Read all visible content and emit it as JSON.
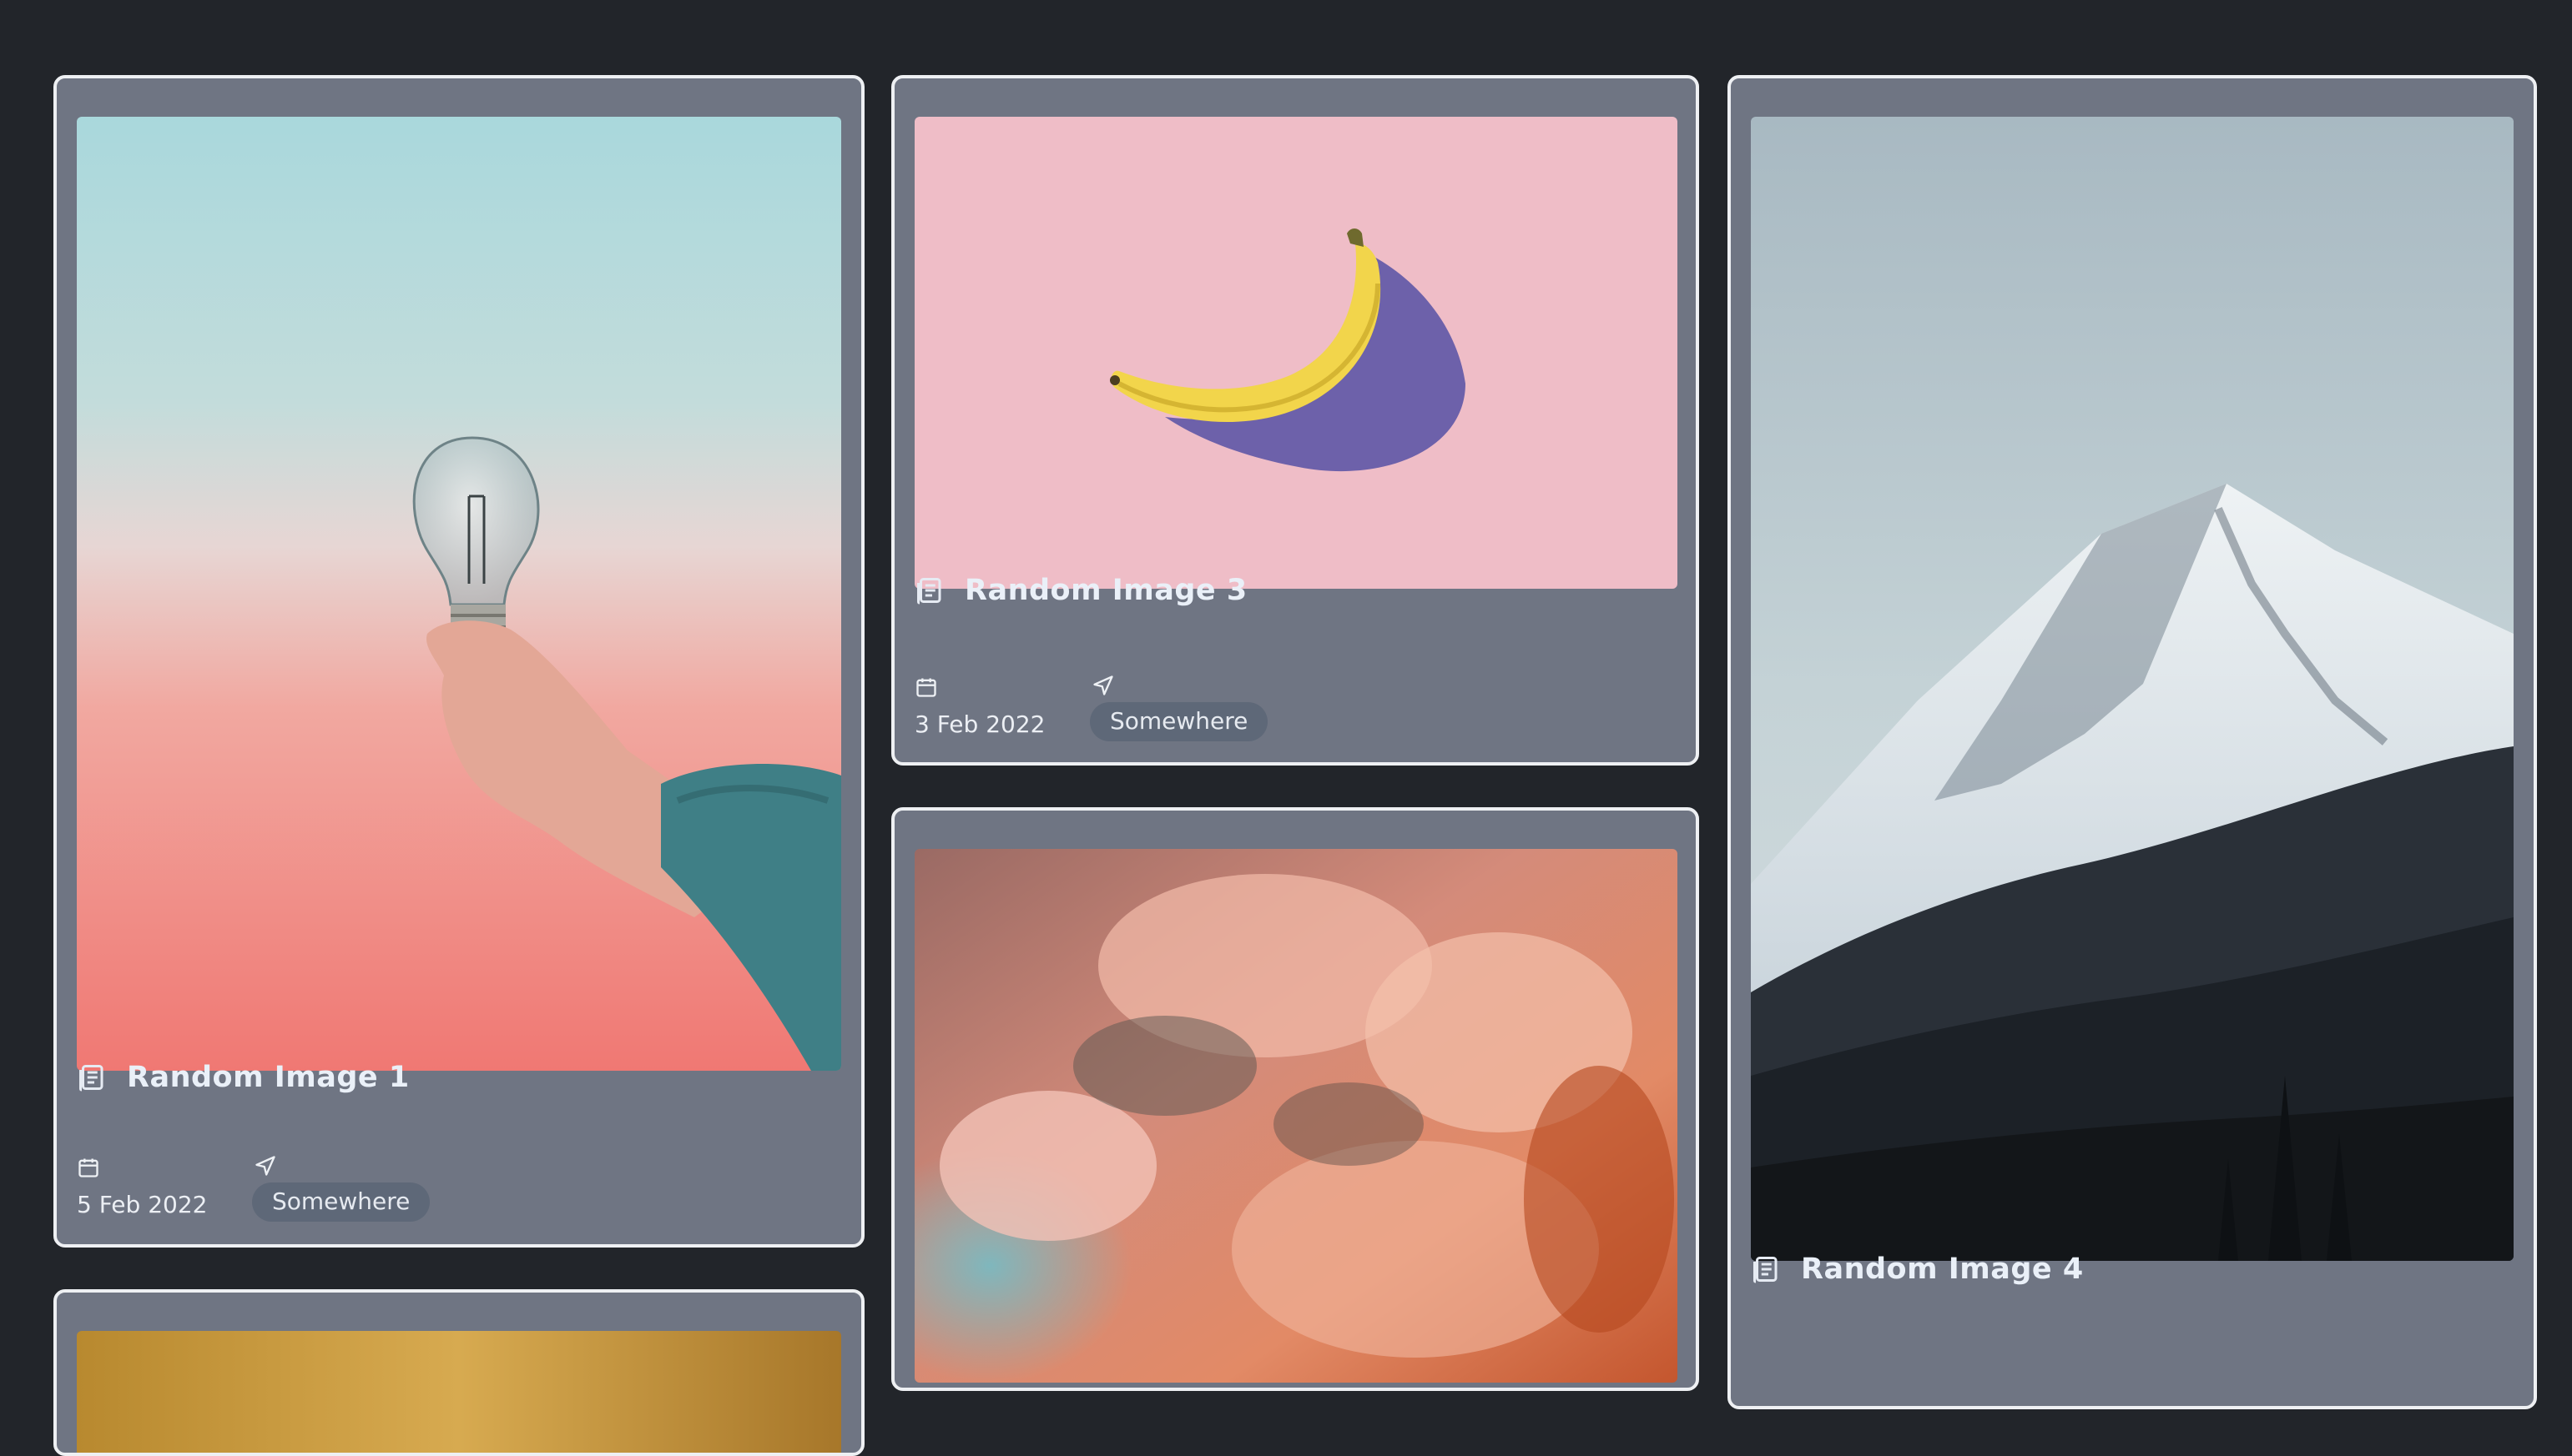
{
  "cards": [
    {
      "title": "Random Image 1",
      "date": "5 Feb 2022",
      "location": "Somewhere",
      "image": "lightbulb-in-hand"
    },
    {
      "title": "Random Image 3",
      "date": "3 Feb 2022",
      "location": "Somewhere",
      "image": "banana-on-pink"
    },
    {
      "title": "Random Image 4",
      "image": "snowy-mountain"
    }
  ],
  "partial_cards": [
    {
      "image": "orange-clouds"
    },
    {
      "image": "golden-strip"
    }
  ],
  "icons": {
    "title": "document-icon",
    "date": "calendar-icon",
    "location": "send-icon"
  },
  "colors": {
    "background": "#22252a",
    "card": "#6f7583",
    "card_border": "#eef0f3",
    "badge": "#5e6878"
  }
}
